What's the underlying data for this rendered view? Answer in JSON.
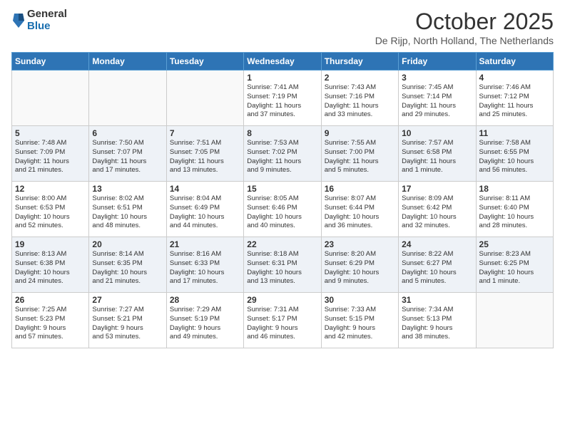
{
  "logo": {
    "general": "General",
    "blue": "Blue"
  },
  "title": "October 2025",
  "location": "De Rijp, North Holland, The Netherlands",
  "days_header": [
    "Sunday",
    "Monday",
    "Tuesday",
    "Wednesday",
    "Thursday",
    "Friday",
    "Saturday"
  ],
  "weeks": [
    [
      {
        "day": "",
        "info": ""
      },
      {
        "day": "",
        "info": ""
      },
      {
        "day": "",
        "info": ""
      },
      {
        "day": "1",
        "info": "Sunrise: 7:41 AM\nSunset: 7:19 PM\nDaylight: 11 hours\nand 37 minutes."
      },
      {
        "day": "2",
        "info": "Sunrise: 7:43 AM\nSunset: 7:16 PM\nDaylight: 11 hours\nand 33 minutes."
      },
      {
        "day": "3",
        "info": "Sunrise: 7:45 AM\nSunset: 7:14 PM\nDaylight: 11 hours\nand 29 minutes."
      },
      {
        "day": "4",
        "info": "Sunrise: 7:46 AM\nSunset: 7:12 PM\nDaylight: 11 hours\nand 25 minutes."
      }
    ],
    [
      {
        "day": "5",
        "info": "Sunrise: 7:48 AM\nSunset: 7:09 PM\nDaylight: 11 hours\nand 21 minutes."
      },
      {
        "day": "6",
        "info": "Sunrise: 7:50 AM\nSunset: 7:07 PM\nDaylight: 11 hours\nand 17 minutes."
      },
      {
        "day": "7",
        "info": "Sunrise: 7:51 AM\nSunset: 7:05 PM\nDaylight: 11 hours\nand 13 minutes."
      },
      {
        "day": "8",
        "info": "Sunrise: 7:53 AM\nSunset: 7:02 PM\nDaylight: 11 hours\nand 9 minutes."
      },
      {
        "day": "9",
        "info": "Sunrise: 7:55 AM\nSunset: 7:00 PM\nDaylight: 11 hours\nand 5 minutes."
      },
      {
        "day": "10",
        "info": "Sunrise: 7:57 AM\nSunset: 6:58 PM\nDaylight: 11 hours\nand 1 minute."
      },
      {
        "day": "11",
        "info": "Sunrise: 7:58 AM\nSunset: 6:55 PM\nDaylight: 10 hours\nand 56 minutes."
      }
    ],
    [
      {
        "day": "12",
        "info": "Sunrise: 8:00 AM\nSunset: 6:53 PM\nDaylight: 10 hours\nand 52 minutes."
      },
      {
        "day": "13",
        "info": "Sunrise: 8:02 AM\nSunset: 6:51 PM\nDaylight: 10 hours\nand 48 minutes."
      },
      {
        "day": "14",
        "info": "Sunrise: 8:04 AM\nSunset: 6:49 PM\nDaylight: 10 hours\nand 44 minutes."
      },
      {
        "day": "15",
        "info": "Sunrise: 8:05 AM\nSunset: 6:46 PM\nDaylight: 10 hours\nand 40 minutes."
      },
      {
        "day": "16",
        "info": "Sunrise: 8:07 AM\nSunset: 6:44 PM\nDaylight: 10 hours\nand 36 minutes."
      },
      {
        "day": "17",
        "info": "Sunrise: 8:09 AM\nSunset: 6:42 PM\nDaylight: 10 hours\nand 32 minutes."
      },
      {
        "day": "18",
        "info": "Sunrise: 8:11 AM\nSunset: 6:40 PM\nDaylight: 10 hours\nand 28 minutes."
      }
    ],
    [
      {
        "day": "19",
        "info": "Sunrise: 8:13 AM\nSunset: 6:38 PM\nDaylight: 10 hours\nand 24 minutes."
      },
      {
        "day": "20",
        "info": "Sunrise: 8:14 AM\nSunset: 6:35 PM\nDaylight: 10 hours\nand 21 minutes."
      },
      {
        "day": "21",
        "info": "Sunrise: 8:16 AM\nSunset: 6:33 PM\nDaylight: 10 hours\nand 17 minutes."
      },
      {
        "day": "22",
        "info": "Sunrise: 8:18 AM\nSunset: 6:31 PM\nDaylight: 10 hours\nand 13 minutes."
      },
      {
        "day": "23",
        "info": "Sunrise: 8:20 AM\nSunset: 6:29 PM\nDaylight: 10 hours\nand 9 minutes."
      },
      {
        "day": "24",
        "info": "Sunrise: 8:22 AM\nSunset: 6:27 PM\nDaylight: 10 hours\nand 5 minutes."
      },
      {
        "day": "25",
        "info": "Sunrise: 8:23 AM\nSunset: 6:25 PM\nDaylight: 10 hours\nand 1 minute."
      }
    ],
    [
      {
        "day": "26",
        "info": "Sunrise: 7:25 AM\nSunset: 5:23 PM\nDaylight: 9 hours\nand 57 minutes."
      },
      {
        "day": "27",
        "info": "Sunrise: 7:27 AM\nSunset: 5:21 PM\nDaylight: 9 hours\nand 53 minutes."
      },
      {
        "day": "28",
        "info": "Sunrise: 7:29 AM\nSunset: 5:19 PM\nDaylight: 9 hours\nand 49 minutes."
      },
      {
        "day": "29",
        "info": "Sunrise: 7:31 AM\nSunset: 5:17 PM\nDaylight: 9 hours\nand 46 minutes."
      },
      {
        "day": "30",
        "info": "Sunrise: 7:33 AM\nSunset: 5:15 PM\nDaylight: 9 hours\nand 42 minutes."
      },
      {
        "day": "31",
        "info": "Sunrise: 7:34 AM\nSunset: 5:13 PM\nDaylight: 9 hours\nand 38 minutes."
      },
      {
        "day": "",
        "info": ""
      }
    ]
  ]
}
